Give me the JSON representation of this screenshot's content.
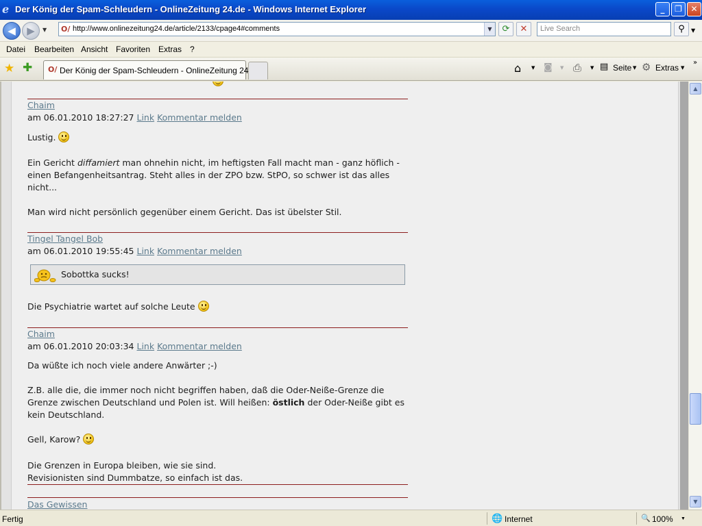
{
  "window": {
    "title": "Der König der Spam-Schleudern - OnlineZeitung 24.de - Windows Internet Explorer"
  },
  "address_bar": {
    "url": "http://www.onlinezeitung24.de/article/2133/cpage4#comments",
    "search_placeholder": "Live Search"
  },
  "menu": {
    "items": [
      "Datei",
      "Bearbeiten",
      "Ansicht",
      "Favoriten",
      "Extras",
      "?"
    ]
  },
  "tabs": {
    "active_label": "Der König der Spam-Schleudern - OnlineZeitung 24.de"
  },
  "toolbar": {
    "page_label": "Seite",
    "tools_label": "Extras"
  },
  "comments": [
    {
      "author": "Chaim",
      "date": "am 06.01.2010 18:27:27",
      "link": "Link",
      "report": "Kommentar melden",
      "p1": "Lustig.",
      "p2a": "Ein Gericht ",
      "p2em": "diffamiert",
      "p2b": " man ohnehin nicht, im heftigsten Fall macht man - ganz höflich -",
      "p2c": "einen Befangenheitsantrag. Steht alles in der ZPO bzw. StPO, so schwer ist das alles",
      "p2d": "nicht...",
      "p3": "Man wird nicht persönlich gegenüber einem Gericht. Das ist übelster Stil."
    },
    {
      "author": "Tingel Tangel Bob",
      "date": "am 06.01.2010 19:55:45",
      "link": "Link",
      "report": "Kommentar melden",
      "quote": "Sobottka sucks!",
      "p1": "Die Psychiatrie wartet auf solche Leute"
    },
    {
      "author": "Chaim",
      "date": "am 06.01.2010 20:03:34",
      "link": "Link",
      "report": "Kommentar melden",
      "p1": "Da wüßte ich noch viele andere Anwärter ;-)",
      "p2a": "Z.B. alle die, die immer noch nicht begriffen haben, daß die Oder-Neiße-Grenze die",
      "p2b": "Grenze zwischen Deutschland und Polen ist. Will heißen: ",
      "p2bold": "östlich",
      "p2c": " der Oder-Neiße gibt es",
      "p2d": "kein Deutschland.",
      "p3": "Gell, Karow?",
      "p4a": "Die Grenzen in Europa bleiben, wie sie sind.",
      "p4b": "Revisionisten sind Dummbatze, so einfach ist das."
    },
    {
      "author": "Das  Gewissen"
    }
  ],
  "status": {
    "left": "Fertig",
    "zone": "Internet",
    "zoom": "100%"
  }
}
